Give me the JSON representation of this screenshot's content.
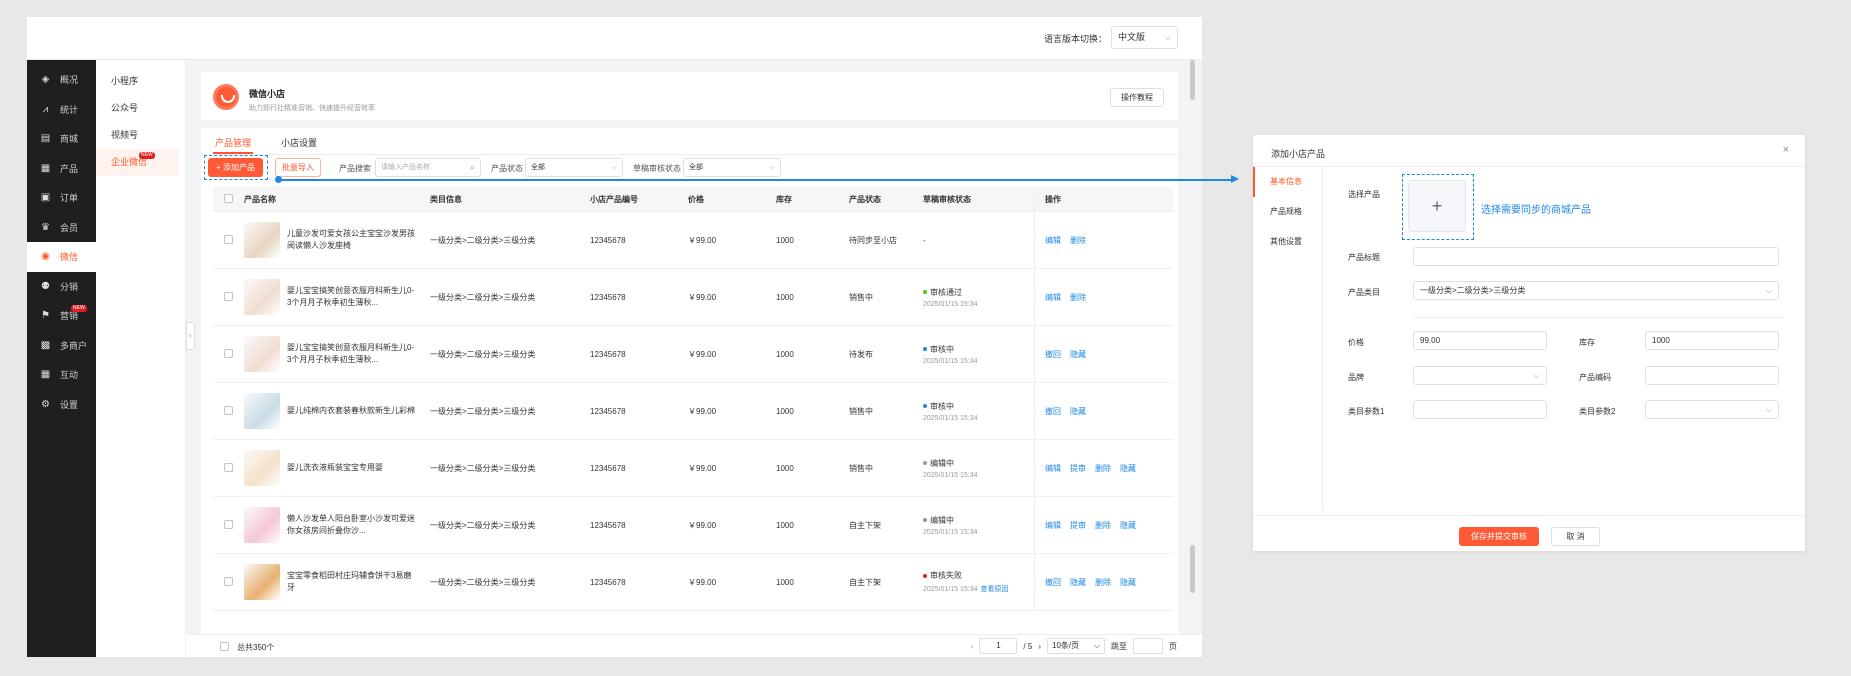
{
  "topbar": {
    "lang_label": "语言版本切换：",
    "lang_value": "中文版"
  },
  "sidebar": {
    "items": [
      {
        "label": "概况",
        "icon": "layers-icon",
        "glyph": "◈"
      },
      {
        "label": "统计",
        "icon": "chart-icon",
        "glyph": "⩘"
      },
      {
        "label": "商城",
        "icon": "store-icon",
        "glyph": "▤"
      },
      {
        "label": "产品",
        "icon": "grid-icon",
        "glyph": "▦"
      },
      {
        "label": "订单",
        "icon": "order-icon",
        "glyph": "▣"
      },
      {
        "label": "会员",
        "icon": "crown-icon",
        "glyph": "♛"
      },
      {
        "label": "微信",
        "icon": "wechat-icon",
        "glyph": "◉"
      },
      {
        "label": "分销",
        "icon": "users-icon",
        "glyph": "⚉"
      },
      {
        "label": "营销",
        "icon": "flag-icon",
        "glyph": "⚑",
        "badge": "NEW"
      },
      {
        "label": "多商户",
        "icon": "shop-icon",
        "glyph": "▩"
      },
      {
        "label": "互动",
        "icon": "apps-icon",
        "glyph": "▦"
      },
      {
        "label": "设置",
        "icon": "gear-icon",
        "glyph": "⚙"
      }
    ]
  },
  "subnav": {
    "items": [
      {
        "label": "小程序"
      },
      {
        "label": "公众号"
      },
      {
        "label": "视频号"
      },
      {
        "label": "企业微信",
        "badge": "NEW"
      }
    ]
  },
  "shop": {
    "title": "微信小店",
    "subtitle": "助力即行社精准营销、快速提升经营效率",
    "tutorial": "操作教程"
  },
  "tabs": [
    "产品管理",
    "小店设置"
  ],
  "toolbar": {
    "add": "+ 添加产品",
    "import": "批量导入",
    "search_label": "产品搜索",
    "search_placeholder": "请输入产品名称",
    "status_label": "产品状态",
    "status_value": "全部",
    "review_label": "草稿审核状态",
    "review_value": "全部"
  },
  "table": {
    "headers": {
      "name": "产品名称",
      "category": "类目信息",
      "code": "小店产品编号",
      "price": "价格",
      "stock": "库存",
      "status": "产品状态",
      "review": "草稿审核状态",
      "ops": "操作"
    },
    "rows": [
      {
        "name": "儿童沙发可爱女孩公主宝宝沙发男孩阅读懒人沙发座椅",
        "category": "一级分类>二级分类>三级分类",
        "code": "12345678",
        "price": "￥99.00",
        "stock": "1000",
        "status": "待同步至小店",
        "review": "-",
        "review_color": "",
        "time": "",
        "link": "",
        "ops": [
          "编辑",
          "删除"
        ],
        "thumb": "#e8d5c0"
      },
      {
        "name": "婴儿宝宝搞笑创意衣服月科新生儿0-3个月月子秋季初生薄秋...",
        "category": "一级分类>二级分类>三级分类",
        "code": "12345678",
        "price": "￥99.00",
        "stock": "1000",
        "status": "销售中",
        "review": "审核通过",
        "review_color": "#52c41a",
        "time": "2025/01/15 15:34",
        "link": "",
        "ops": [
          "编辑",
          "删除"
        ],
        "thumb": "#f0ddd0"
      },
      {
        "name": "婴儿宝宝搞笑创意衣服月科新生儿0-3个月月子秋季初生薄秋...",
        "category": "一级分类>二级分类>三级分类",
        "code": "12345678",
        "price": "￥99.00",
        "stock": "1000",
        "status": "待发布",
        "review": "审核中",
        "review_color": "#1e88e5",
        "time": "2025/01/15 15:34",
        "link": "",
        "ops": [
          "撤回",
          "隐藏"
        ],
        "thumb": "#f0ddd0"
      },
      {
        "name": "婴儿纯棉内衣套装春秋款新生儿彩棉",
        "category": "一级分类>二级分类>三级分类",
        "code": "12345678",
        "price": "￥99.00",
        "stock": "1000",
        "status": "销售中",
        "review": "审核中",
        "review_color": "#1e88e5",
        "time": "2025/01/15 15:34",
        "link": "",
        "ops": [
          "撤回",
          "隐藏"
        ],
        "thumb": "#c9dce4"
      },
      {
        "name": "婴儿洗衣液瓶装宝宝专用婴",
        "category": "一级分类>二级分类>三级分类",
        "code": "12345678",
        "price": "￥99.00",
        "stock": "1000",
        "status": "销售中",
        "review": "编辑中",
        "review_color": "#999999",
        "time": "2025/01/15 15:34",
        "link": "",
        "ops": [
          "编辑",
          "提审",
          "删除",
          "隐藏"
        ],
        "thumb": "#f5e0c8"
      },
      {
        "name": "懒人沙发单人阳台卧室小沙发可爱迷你女孩房间折叠你沙...",
        "category": "一级分类>二级分类>三级分类",
        "code": "12345678",
        "price": "￥99.00",
        "stock": "1000",
        "status": "自主下架",
        "review": "编辑中",
        "review_color": "#999999",
        "time": "2025/01/15 15:34",
        "link": "",
        "ops": [
          "编辑",
          "提审",
          "删除",
          "隐藏"
        ],
        "thumb": "#f4c6d4"
      },
      {
        "name": "宝宝零食稻田村庄玛辅食饼干3易磨牙",
        "category": "一级分类>二级分类>三级分类",
        "code": "12345678",
        "price": "￥99.00",
        "stock": "1000",
        "status": "自主下架",
        "review": "审核失败",
        "review_color": "#e02020",
        "time": "2025/01/15 15:34",
        "link": "查看原因",
        "ops": [
          "撤回",
          "隐藏",
          "删除",
          "隐藏"
        ],
        "thumb": "#e8b070"
      }
    ]
  },
  "footer": {
    "total": "总共350个",
    "page": "1",
    "pages": "/ 5",
    "per_page": "10条/页",
    "jump": "跳至",
    "page_unit": "页",
    "prev": "‹",
    "next": "›"
  },
  "modal": {
    "title": "添加小店产品",
    "close": "×",
    "tabs": [
      "基本信息",
      "产品规格",
      "其他设置"
    ],
    "select_product_label": "选择产品",
    "upload_plus": "+",
    "upload_hint": "选择需要同步的商城产品",
    "title_label": "产品标题",
    "category_label": "产品类目",
    "category_value": "一级分类>二级分类>三级分类",
    "price_label": "价格",
    "price_value": "99.00",
    "stock_label": "库存",
    "stock_value": "1000",
    "brand_label": "品牌",
    "code_label": "产品编码",
    "param1_label": "类目参数1",
    "param2_label": "类目参数2",
    "save": "保存并提交审核",
    "cancel": "取 消"
  },
  "colors": {
    "accent": "#ff5a36",
    "link": "#1e88e5",
    "sidebar": "#1f1f1f"
  }
}
